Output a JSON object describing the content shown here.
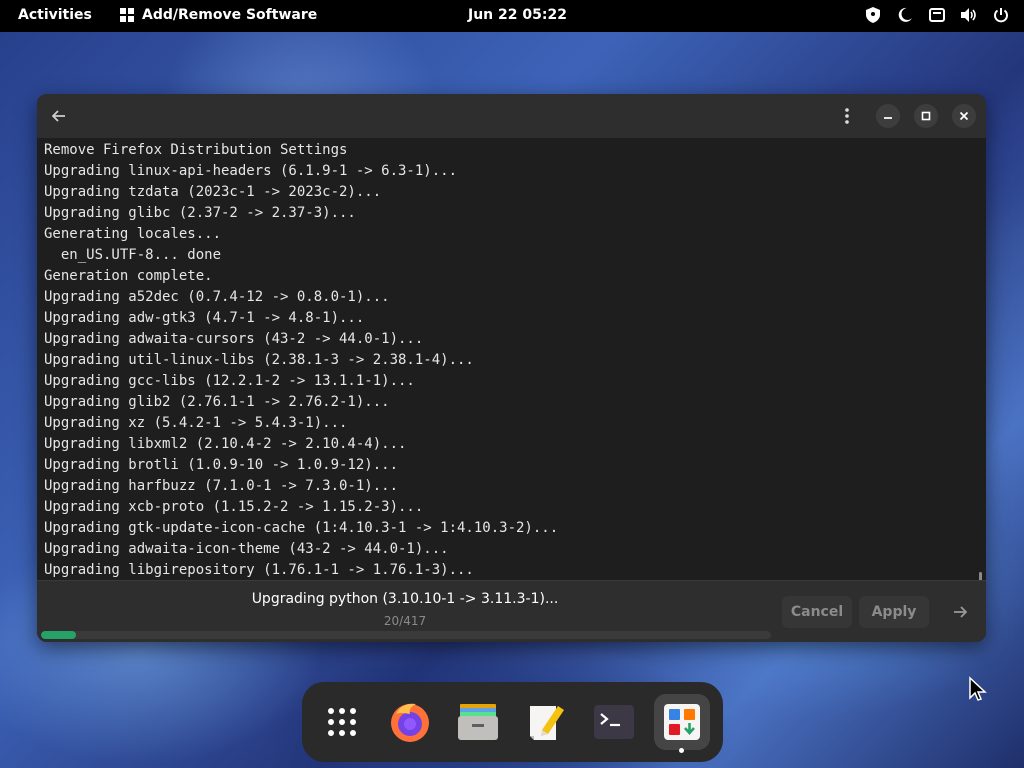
{
  "topbar": {
    "activities": "Activities",
    "app_name": "Add/Remove Software",
    "clock": "Jun 22  05:22"
  },
  "log": {
    "lines": [
      "Remove Firefox Distribution Settings",
      "Upgrading linux-api-headers (6.1.9-1 -> 6.3-1)...",
      "Upgrading tzdata (2023c-1 -> 2023c-2)...",
      "Upgrading glibc (2.37-2 -> 2.37-3)...",
      "Generating locales...",
      "  en_US.UTF-8... done",
      "Generation complete.",
      "Upgrading a52dec (0.7.4-12 -> 0.8.0-1)...",
      "Upgrading adw-gtk3 (4.7-1 -> 4.8-1)...",
      "Upgrading adwaita-cursors (43-2 -> 44.0-1)...",
      "Upgrading util-linux-libs (2.38.1-3 -> 2.38.1-4)...",
      "Upgrading gcc-libs (12.2.1-2 -> 13.1.1-1)...",
      "Upgrading glib2 (2.76.1-1 -> 2.76.2-1)...",
      "Upgrading xz (5.4.2-1 -> 5.4.3-1)...",
      "Upgrading libxml2 (2.10.4-2 -> 2.10.4-4)...",
      "Upgrading brotli (1.0.9-10 -> 1.0.9-12)...",
      "Upgrading harfbuzz (7.1.0-1 -> 7.3.0-1)...",
      "Upgrading xcb-proto (1.15.2-2 -> 1.15.2-3)...",
      "Upgrading gtk-update-icon-cache (1:4.10.3-1 -> 1:4.10.3-2)...",
      "Upgrading adwaita-icon-theme (43-2 -> 44.0-1)...",
      "Upgrading libgirepository (1.76.1-1 -> 1.76.1-3)..."
    ]
  },
  "transaction": {
    "status": "Upgrading python (3.10.10-1 -> 3.11.3-1)...",
    "count": "20/417",
    "progress_fraction": 0.048,
    "cancel_label": "Cancel",
    "apply_label": "Apply"
  },
  "dock": {
    "items": [
      "show-apps-icon",
      "firefox-icon",
      "files-icon",
      "text-editor-icon",
      "terminal-icon",
      "software-icon"
    ]
  },
  "colors": {
    "accent_green": "#26a269",
    "window_bg": "#242424",
    "topbar_bg": "#000000"
  }
}
